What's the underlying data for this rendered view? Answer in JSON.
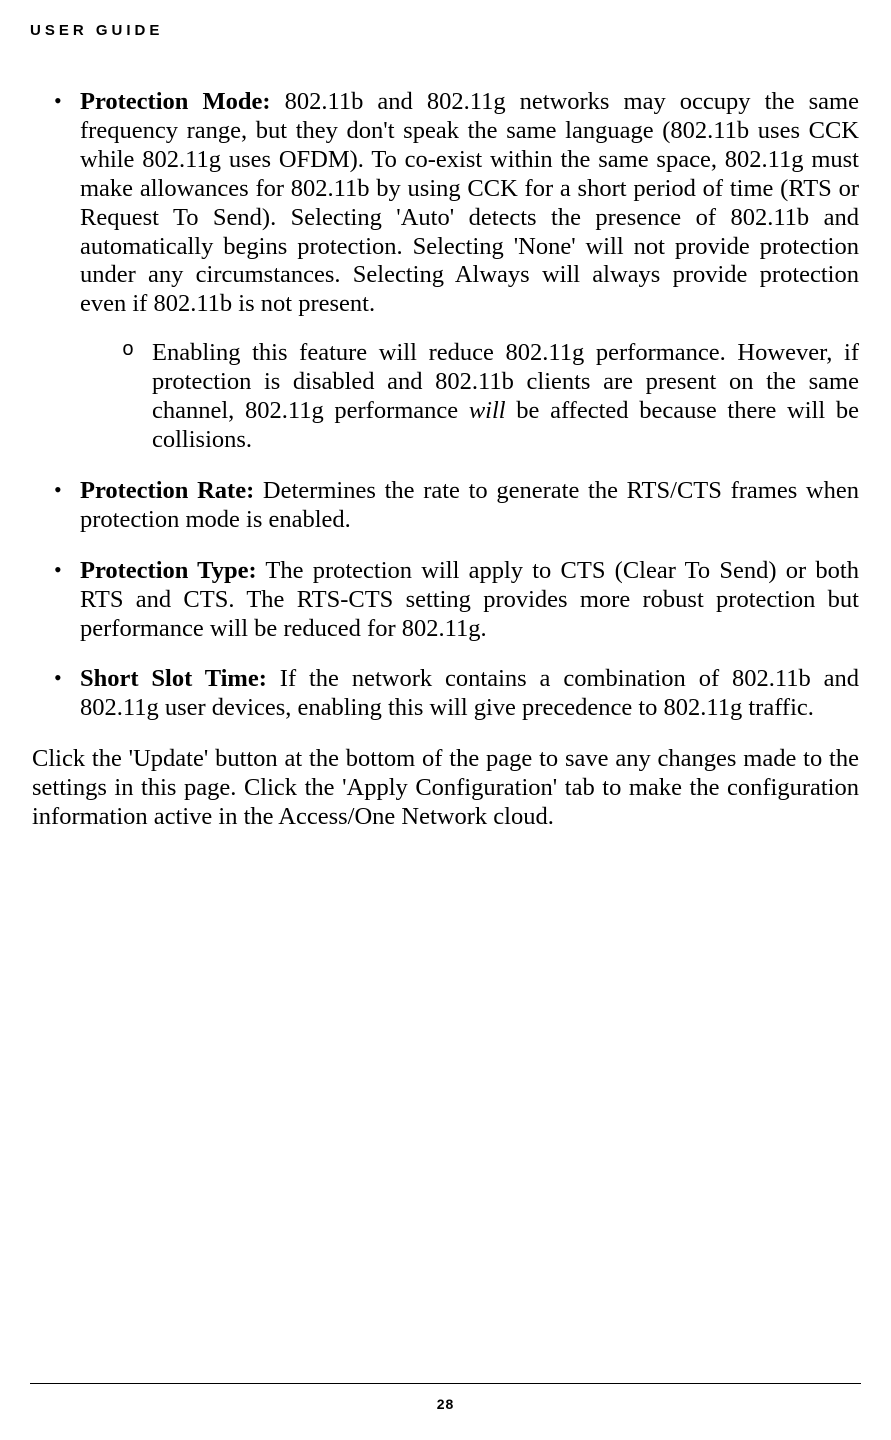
{
  "header": "USER GUIDE",
  "bullets": [
    {
      "title": "Protection Mode:",
      "text": " 802.11b and 802.11g networks may occupy the same frequency range, but they don't speak the same language (802.11b uses CCK while 802.11g uses OFDM). To co-exist within the same space, 802.11g must make allowances for 802.11b by using CCK for a short period of time (RTS or Request To Send). Selecting 'Auto' detects the presence of 802.11b and automatically begins protection. Selecting 'None' will not provide protection under any circumstances. Selecting Always will always provide protection even if 802.11b is not present.",
      "sub": {
        "pre": "Enabling this feature will reduce 802.11g performance. However, if protection is disabled and 802.11b clients are present on the same channel, 802.11g performance ",
        "italic": "will",
        "post": " be affected because there will be collisions."
      }
    },
    {
      "title": "Protection Rate:",
      "text": " Determines the rate to generate the RTS/CTS frames when protection mode is enabled."
    },
    {
      "title": "Protection Type:",
      "text": " The protection will apply to CTS (Clear To Send) or both RTS and CTS. The RTS-CTS setting provides more robust protection but performance will be reduced for 802.11g."
    },
    {
      "title": "Short Slot Time:",
      "text": " If the network contains a combination of 802.11b and 802.11g user devices, enabling this will give precedence to 802.11g traffic."
    }
  ],
  "closing": "Click the 'Update' button at the bottom of the page to save any changes made to the settings in this page. Click the 'Apply Configuration' tab to make the configuration information active in the Access/One Network cloud.",
  "pageNumber": "28"
}
